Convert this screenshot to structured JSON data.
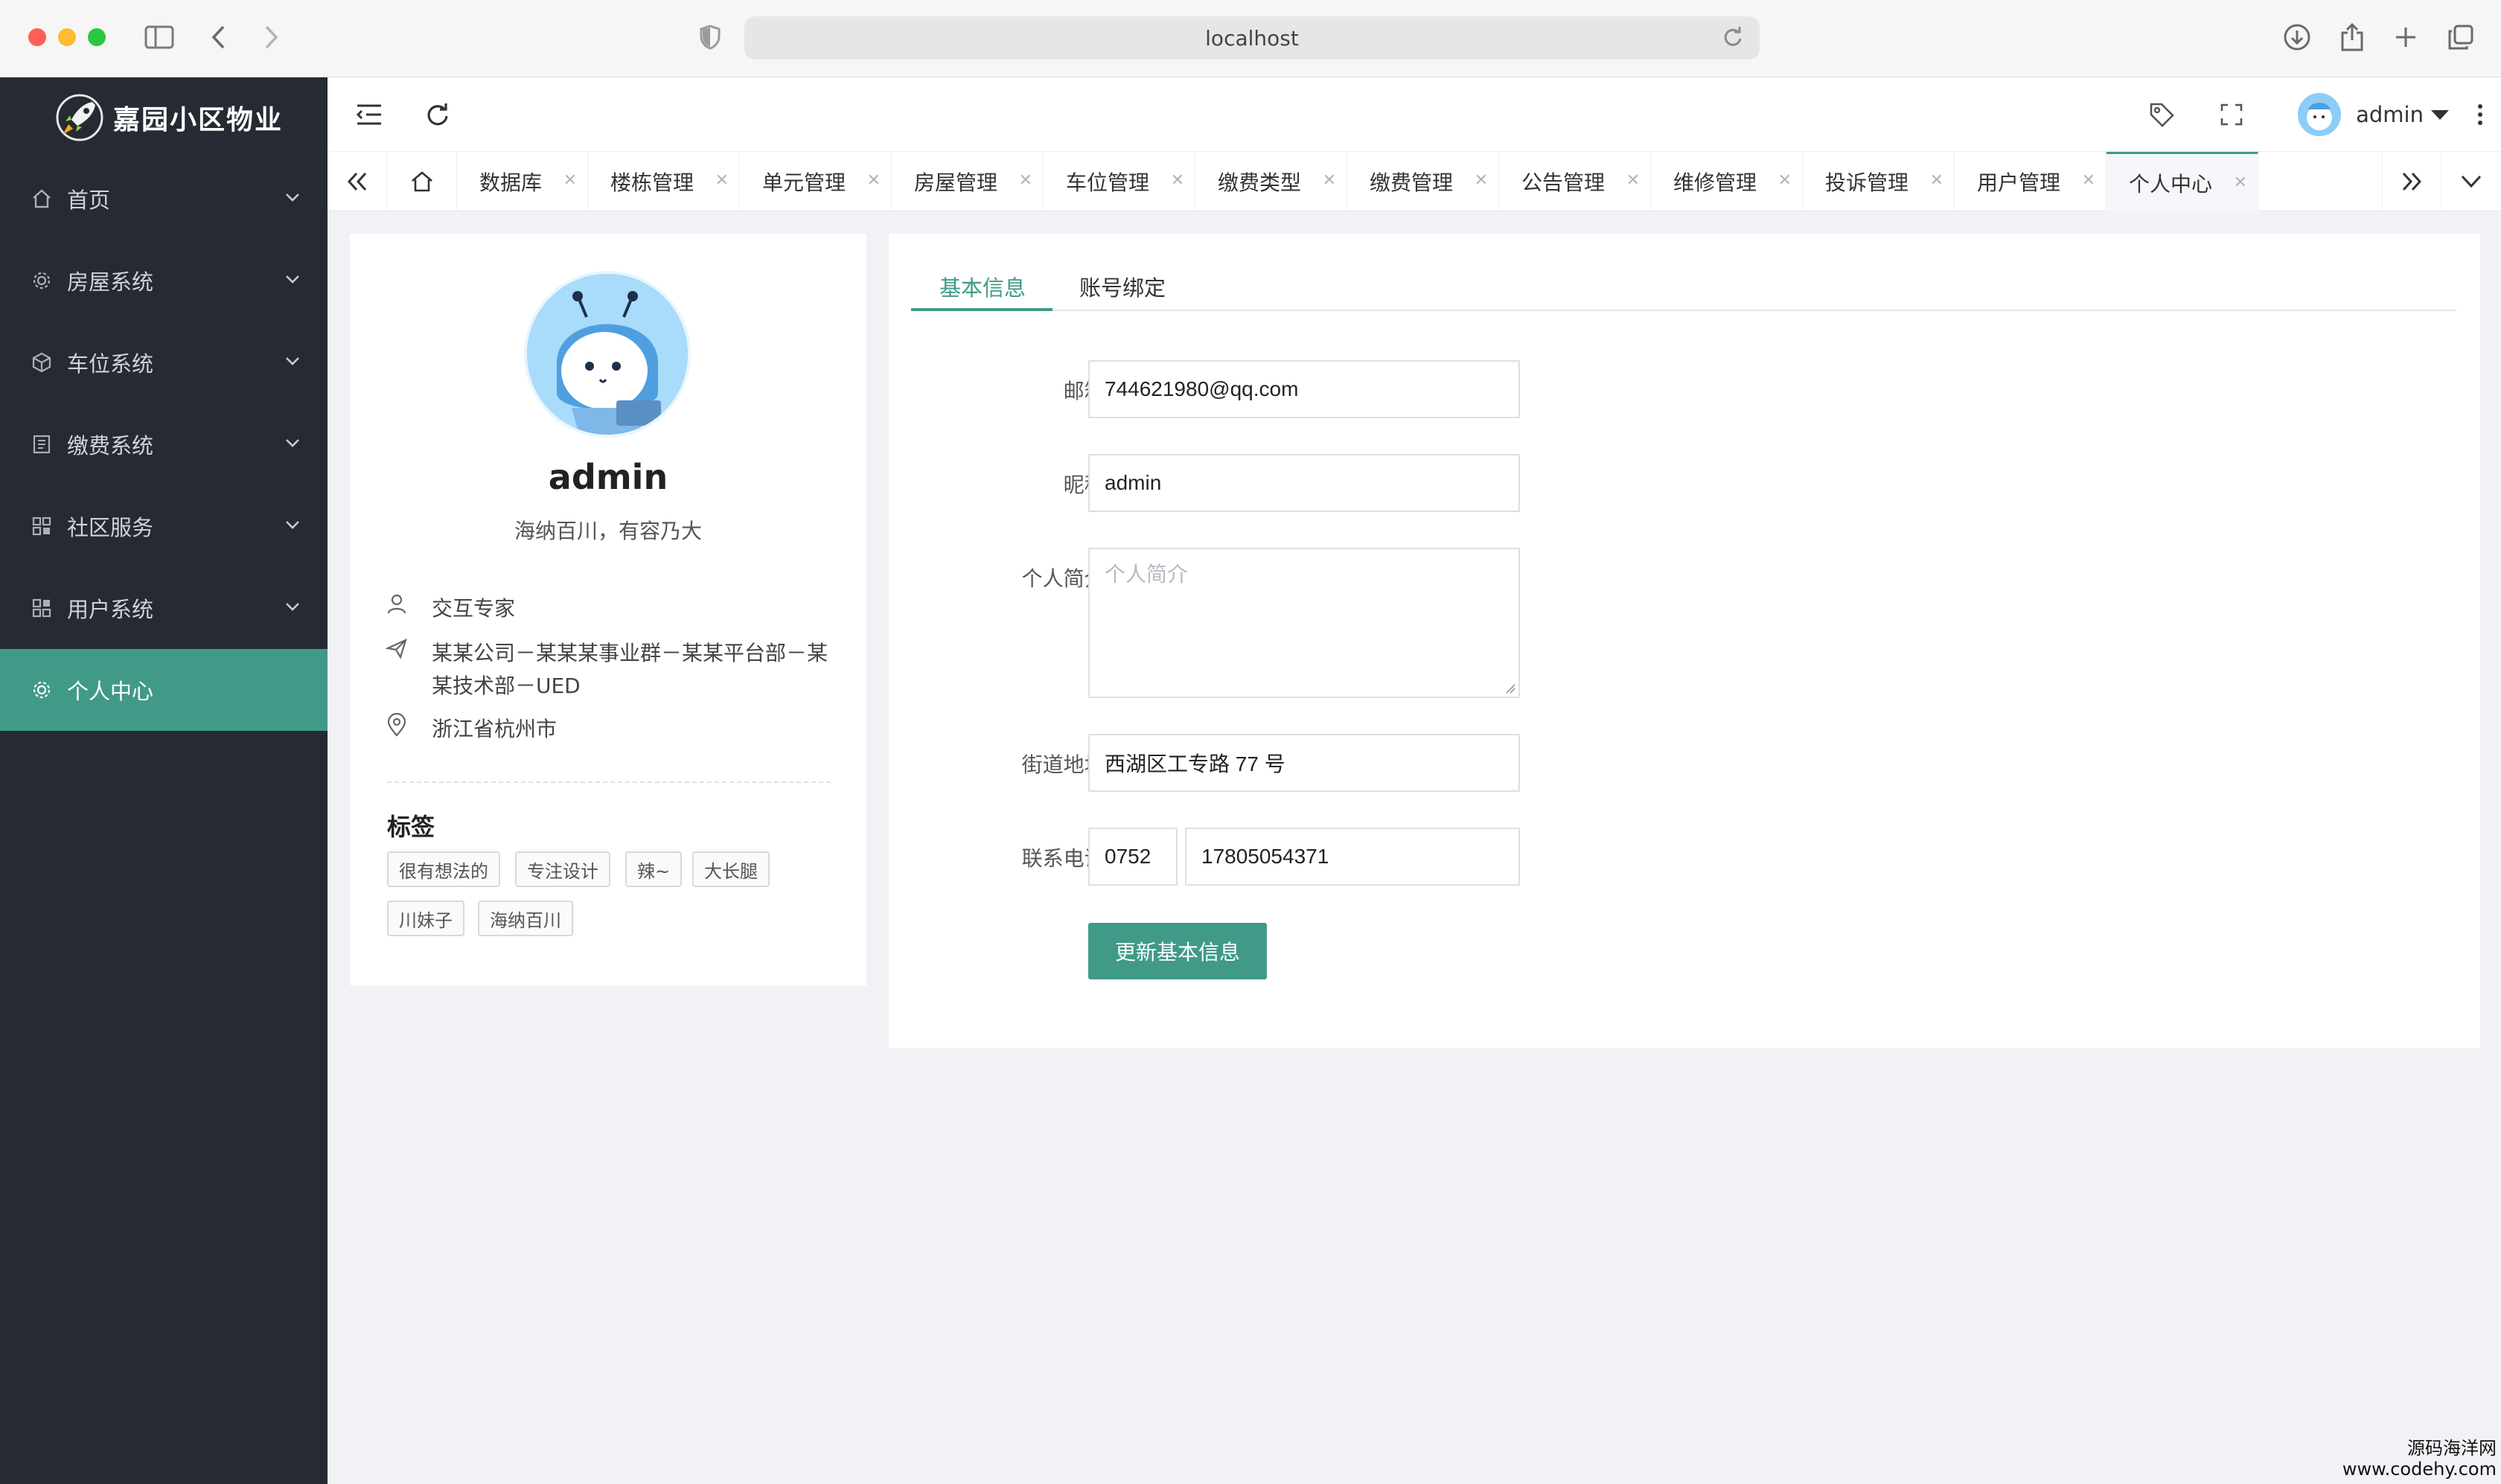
{
  "browser": {
    "url": "localhost",
    "traffic_colors": [
      "#fe5f57",
      "#febc2e",
      "#28c840"
    ]
  },
  "brand": {
    "name": "嘉园小区物业",
    "accent": "#409a87"
  },
  "sidebar": {
    "items": [
      {
        "label": "首页",
        "icon": "home-icon"
      },
      {
        "label": "房屋系统",
        "icon": "gear-icon"
      },
      {
        "label": "车位系统",
        "icon": "cube-icon"
      },
      {
        "label": "缴费系统",
        "icon": "document-icon"
      },
      {
        "label": "社区服务",
        "icon": "grid-icon"
      },
      {
        "label": "用户系统",
        "icon": "grid-icon"
      },
      {
        "label": "个人中心",
        "icon": "gear-icon",
        "active": true
      }
    ]
  },
  "header": {
    "username": "admin"
  },
  "tabs": [
    {
      "label": "数据库"
    },
    {
      "label": "楼栋管理"
    },
    {
      "label": "单元管理"
    },
    {
      "label": "房屋管理"
    },
    {
      "label": "车位管理"
    },
    {
      "label": "缴费类型"
    },
    {
      "label": "缴费管理"
    },
    {
      "label": "公告管理"
    },
    {
      "label": "维修管理"
    },
    {
      "label": "投诉管理"
    },
    {
      "label": "用户管理"
    },
    {
      "label": "个人中心",
      "active": true
    }
  ],
  "profile": {
    "name": "admin",
    "motto": "海纳百川，有容乃大",
    "title": "交互专家",
    "org": "某某公司－某某某事业群－某某平台部－某某技术部－UED",
    "location": "浙江省杭州市",
    "tags_title": "标签",
    "tags": [
      "很有想法的",
      "专注设计",
      "辣~",
      "大长腿",
      "川妹子",
      "海纳百川"
    ]
  },
  "form": {
    "tabs": [
      "基本信息",
      "账号绑定"
    ],
    "email_label": "邮箱:",
    "email_value": "744621980@qq.com",
    "nickname_label": "昵称:",
    "nickname_value": "admin",
    "bio_label": "个人简介:",
    "bio_placeholder": "个人简介",
    "address_label": "街道地址:",
    "address_value": "西湖区工专路 77 号",
    "phone_label": "联系电话:",
    "phone_area": "0752",
    "phone_number": "17805054371",
    "submit_label": "更新基本信息"
  },
  "watermark": {
    "line1": "源码海洋网",
    "line2": "www.codehy.com"
  }
}
